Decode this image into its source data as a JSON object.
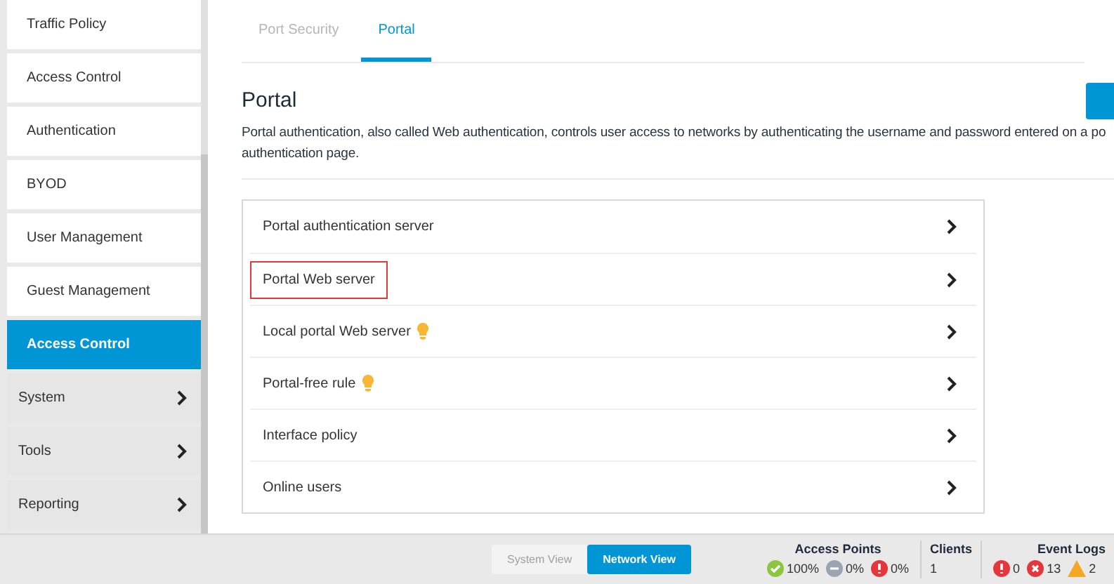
{
  "sidebar": {
    "items": [
      {
        "label": "Traffic Policy",
        "kind": "sub",
        "selected": false
      },
      {
        "label": "Access Control",
        "kind": "sub",
        "selected": false
      },
      {
        "label": "Authentication",
        "kind": "sub",
        "selected": false
      },
      {
        "label": "BYOD",
        "kind": "sub",
        "selected": false
      },
      {
        "label": "User Management",
        "kind": "sub",
        "selected": false
      },
      {
        "label": "Guest Management",
        "kind": "sub",
        "selected": false
      },
      {
        "label": "Access Control",
        "kind": "sub",
        "selected": true
      },
      {
        "label": "System",
        "kind": "group",
        "selected": false
      },
      {
        "label": "Tools",
        "kind": "group",
        "selected": false
      },
      {
        "label": "Reporting",
        "kind": "group",
        "selected": false
      }
    ]
  },
  "tabs": [
    {
      "label": "Port Security",
      "selected": false
    },
    {
      "label": "Portal",
      "selected": true
    }
  ],
  "section": {
    "title": "Portal",
    "description_lines": [
      "Portal authentication, also called Web authentication, controls user access to networks by authenticating the username and password entered on a po",
      "authentication page."
    ]
  },
  "menu": [
    {
      "label": "Portal authentication server",
      "tip": false,
      "highlighted": false
    },
    {
      "label": "Portal Web server",
      "tip": false,
      "highlighted": true
    },
    {
      "label": "Local portal Web server",
      "tip": true,
      "highlighted": false
    },
    {
      "label": "Portal-free rule",
      "tip": true,
      "highlighted": false
    },
    {
      "label": "Interface policy",
      "tip": false,
      "highlighted": false
    },
    {
      "label": "Online users",
      "tip": false,
      "highlighted": false
    }
  ],
  "footer": {
    "views": [
      {
        "label": "System View",
        "selected": false
      },
      {
        "label": "Network View",
        "selected": true
      }
    ],
    "access_points": {
      "title": "Access Points",
      "stats": [
        {
          "kind": "ok",
          "value": "100%"
        },
        {
          "kind": "off",
          "value": "0%"
        },
        {
          "kind": "alert",
          "value": "0%"
        }
      ]
    },
    "clients": {
      "title": "Clients",
      "value": "1"
    },
    "event_logs": {
      "title": "Event Logs",
      "stats": [
        {
          "kind": "alert",
          "value": "0"
        },
        {
          "kind": "error",
          "value": "13"
        },
        {
          "kind": "warning",
          "value": "2"
        }
      ]
    }
  }
}
